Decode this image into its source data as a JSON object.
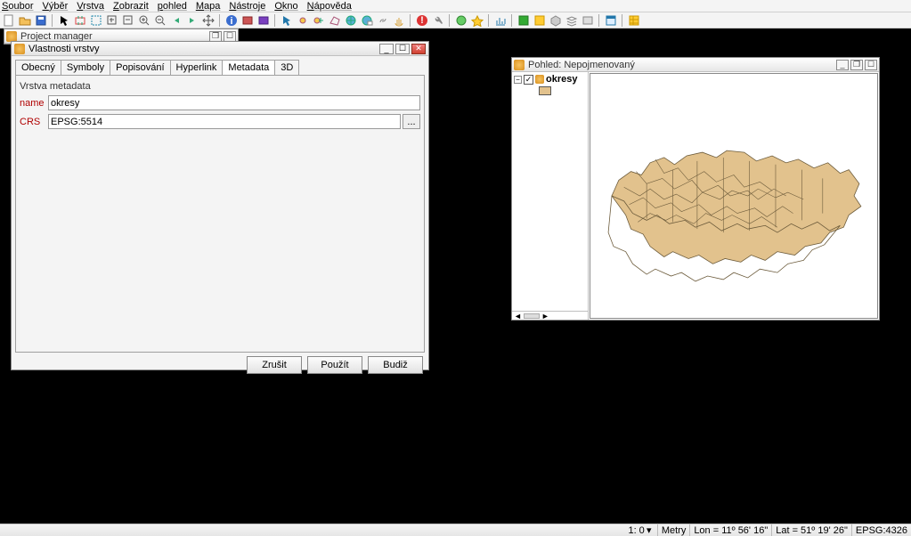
{
  "menus": [
    "Soubor",
    "Výběr",
    "Vrstva",
    "Zobrazit",
    "pohled",
    "Mapa",
    "Nástroje",
    "Okno",
    "Nápověda"
  ],
  "project_manager": {
    "title": "Project manager"
  },
  "properties": {
    "title": "Vlastnosti vrstvy",
    "tabs": [
      "Obecný",
      "Symboly",
      "Popisování",
      "Hyperlink",
      "Metadata",
      "3D"
    ],
    "active_tab": 4,
    "section_label": "Vrstva metadata",
    "fields": {
      "name_label": "name",
      "name_value": "okresy",
      "crs_label": "CRS",
      "crs_value": "EPSG:5514",
      "crs_browse": "..."
    },
    "buttons": {
      "cancel": "Zrušit",
      "apply": "Použít",
      "ok": "Budiž"
    }
  },
  "mapview": {
    "title": "Pohled: Nepojmenovaný",
    "layer_name": "okresy",
    "fill_color": "#e2c28d"
  },
  "status": {
    "scale": "1: 0",
    "units": "Metry",
    "lon": "Lon = 11º 56' 16\"",
    "lat": "Lat = 51º 19' 26\"",
    "epsg": "EPSG:4326"
  }
}
